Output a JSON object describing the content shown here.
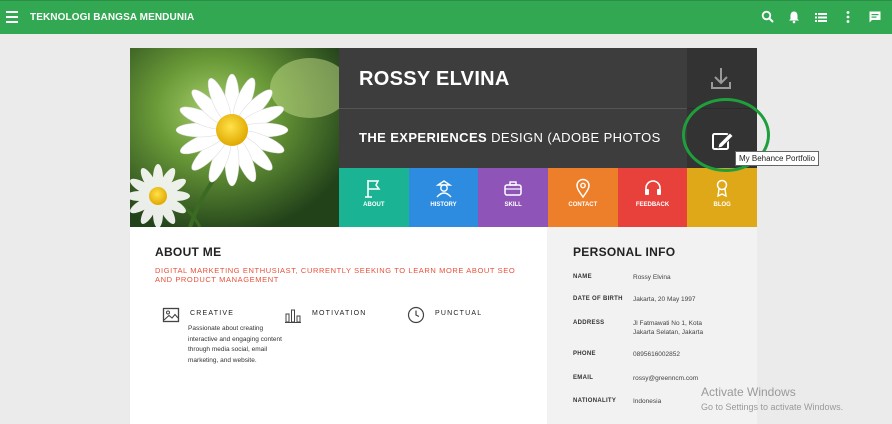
{
  "topbar": {
    "title": "TEKNOLOGI BANGSA MENDUNIA",
    "icons": [
      "menu-icon",
      "search-icon",
      "bell-icon",
      "list-icon",
      "more-vertical-icon",
      "chat-icon"
    ]
  },
  "profile": {
    "name": "ROSSY ELVINA",
    "headline_bold": "THE EXPERIENCES",
    "headline_rest": " DESIGN (ADOBE PHOTOS"
  },
  "nav_tiles": [
    {
      "label": "ABOUT",
      "color": "#1ab394",
      "icon": "flag-icon"
    },
    {
      "label": "HISTORY",
      "color": "#2e8ce0",
      "icon": "person-icon"
    },
    {
      "label": "SKILL",
      "color": "#8e54b8",
      "icon": "briefcase-icon"
    },
    {
      "label": "CONTACT",
      "color": "#ee7f2a",
      "icon": "map-pin-icon"
    },
    {
      "label": "FEEDBACK",
      "color": "#e8413b",
      "icon": "headset-icon"
    },
    {
      "label": "BLOG",
      "color": "#dfa819",
      "icon": "award-icon"
    }
  ],
  "about": {
    "title": "ABOUT ME",
    "tagline": "DIGITAL MARKETING ENTHUSIAST, CURRENTLY SEEKING TO LEARN MORE ABOUT SEO AND PRODUCT MANAGEMENT",
    "traits": [
      {
        "name": "CREATIVE",
        "icon": "image-icon"
      },
      {
        "name": "MOTIVATION",
        "icon": "bar-chart-icon"
      },
      {
        "name": "PUNCTUAL",
        "icon": "clock-icon"
      }
    ],
    "creative_desc": "Passionate about creating interactive and engaging content through media social, email marketing, and website."
  },
  "personal_info": {
    "title": "PERSONAL INFO",
    "rows": [
      {
        "key": "NAME",
        "value": "Rossy Elvina"
      },
      {
        "key": "DATE OF BIRTH",
        "value": "Jakarta, 20 May 1997"
      },
      {
        "key": "ADDRESS",
        "value": "Jl Fatmawati No 1, Kota Jakarta Selatan, Jakarta"
      },
      {
        "key": "PHONE",
        "value": "0895616002852"
      },
      {
        "key": "EMAIL",
        "value": "rossy@greenncm.com"
      },
      {
        "key": "NATIONALITY",
        "value": "Indonesia"
      }
    ]
  },
  "tooltip": "My Behance Portfolio",
  "watermark": {
    "line1": "Activate Windows",
    "line2": "Go to Settings to activate Windows."
  },
  "colors": {
    "topbar": "#33a853",
    "accent_red": "#e8503a",
    "highlight_circle": "#1f9e3c"
  }
}
